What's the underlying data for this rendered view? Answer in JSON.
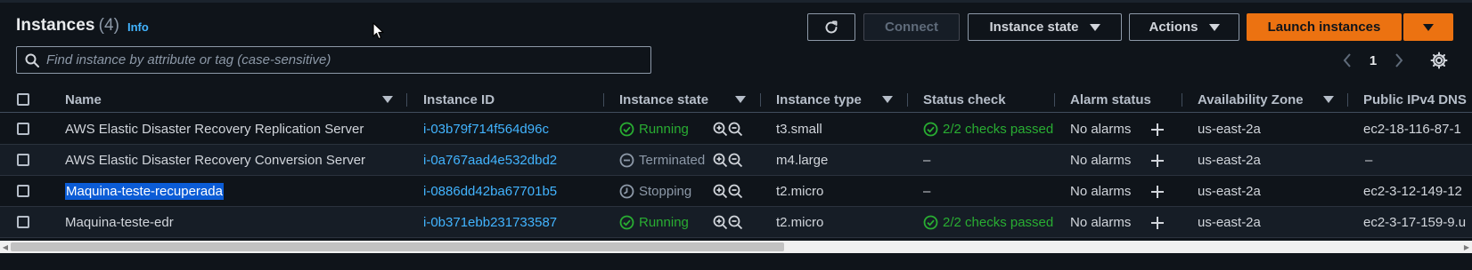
{
  "header": {
    "title": "Instances",
    "count": "(4)",
    "info": "Info"
  },
  "toolbar": {
    "refresh_icon": "refresh-icon",
    "connect": "Connect",
    "instance_state": "Instance state",
    "actions": "Actions",
    "launch": "Launch instances"
  },
  "search": {
    "placeholder": "Find instance by attribute or tag (case-sensitive)",
    "value": ""
  },
  "pagination": {
    "page": "1"
  },
  "columns": {
    "name": "Name",
    "instance_id": "Instance ID",
    "instance_state": "Instance state",
    "instance_type": "Instance type",
    "status_check": "Status check",
    "alarm_status": "Alarm status",
    "availability_zone": "Availability Zone",
    "public_dns": "Public IPv4 DNS"
  },
  "rows": [
    {
      "name": "AWS Elastic Disaster Recovery Replication Server",
      "id": "i-03b79f714f564d96c",
      "state": "Running",
      "type": "t3.small",
      "status": "2/2 checks passed",
      "alarm": "No alarms",
      "az": "us-east-2a",
      "dns": "ec2-18-116-87-1"
    },
    {
      "name": "AWS Elastic Disaster Recovery Conversion Server",
      "id": "i-0a767aad4e532dbd2",
      "state": "Terminated",
      "type": "m4.large",
      "status": "–",
      "alarm": "No alarms",
      "az": "us-east-2a",
      "dns": "–"
    },
    {
      "name": "Maquina-teste-recuperada",
      "id": "i-0886dd42ba67701b5",
      "state": "Stopping",
      "type": "t2.micro",
      "status": "–",
      "alarm": "No alarms",
      "az": "us-east-2a",
      "dns": "ec2-3-12-149-12"
    },
    {
      "name": "Maquina-teste-edr",
      "id": "i-0b371ebb231733587",
      "state": "Running",
      "type": "t2.micro",
      "status": "2/2 checks passed",
      "alarm": "No alarms",
      "az": "us-east-2a",
      "dns": "ec2-3-17-159-9.u"
    }
  ],
  "colors": {
    "background": "#0f141a",
    "link": "#42b4ff",
    "accent": "#ec7211",
    "success": "#29ad32",
    "selection": "#0b5cd6"
  }
}
